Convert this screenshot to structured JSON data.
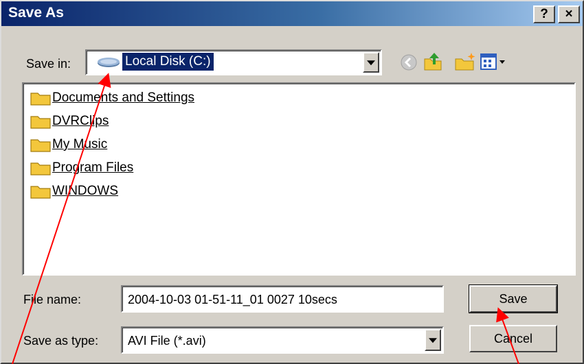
{
  "window": {
    "title": "Save As",
    "help_label": "?",
    "close_label": "×"
  },
  "save_in": {
    "label": "Save in:",
    "value": "Local Disk (C:)",
    "icon": "hard-drive-icon"
  },
  "toolbar": {
    "back_icon": "back-icon",
    "up_icon": "up-folder-icon",
    "new_folder_icon": "new-folder-icon",
    "views_icon": "views-menu-icon"
  },
  "files": {
    "items": [
      {
        "label": "Documents and Settings"
      },
      {
        "label": "DVRClips"
      },
      {
        "label": "My Music"
      },
      {
        "label": "Program Files"
      },
      {
        "label": "WINDOWS"
      }
    ]
  },
  "filename": {
    "label": "File name:",
    "value": "2004-10-03 01-51-11_01 0027 10secs"
  },
  "filetype": {
    "label": "Save as type:",
    "value": "AVI File (*.avi)"
  },
  "buttons": {
    "save_label": "Save",
    "cancel_label": "Cancel"
  },
  "colors": {
    "title_gradient_start": "#0a246a",
    "title_gradient_end": "#a6caf0",
    "dialog_face": "#d4d0c8",
    "selection": "#0a246a",
    "annotation_arrow": "#ff0000"
  }
}
